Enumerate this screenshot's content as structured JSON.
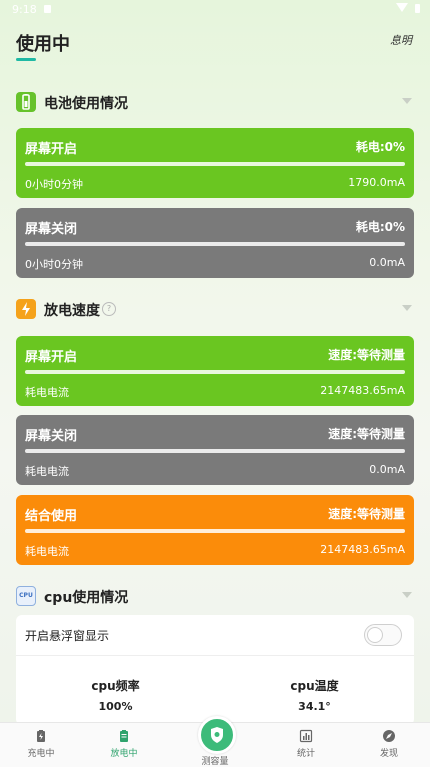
{
  "status_bar": {
    "time": "9:18"
  },
  "header": {
    "title": "使用中",
    "right_label": "息明"
  },
  "battery_section": {
    "title": "电池使用情况",
    "cards": [
      {
        "name": "屏幕开启",
        "consumption": "耗电:0%",
        "duration": "0小时0分钟",
        "current": "1790.0mA",
        "color": "#6ac621"
      },
      {
        "name": "屏幕关闭",
        "consumption": "耗电:0%",
        "duration": "0小时0分钟",
        "current": "0.0mA",
        "color": "#7a7a7a"
      }
    ]
  },
  "discharge_section": {
    "title": "放电速度",
    "cards": [
      {
        "name": "屏幕开启",
        "speed": "速度:等待测量",
        "label": "耗电电流",
        "current": "2147483.65mA",
        "color": "#6ac621"
      },
      {
        "name": "屏幕关闭",
        "speed": "速度:等待测量",
        "label": "耗电电流",
        "current": "0.0mA",
        "color": "#7a7a7a"
      },
      {
        "name": "结合使用",
        "speed": "速度:等待测量",
        "label": "耗电电流",
        "current": "2147483.65mA",
        "color": "#fb8c0a"
      }
    ]
  },
  "cpu_section": {
    "title": "cpu使用情况",
    "icon_text": "CPU",
    "floating_toggle_label": "开启悬浮窗显示",
    "floating_toggle_on": false,
    "frequency_label": "cpu频率",
    "frequency_value": "100%",
    "temperature_label": "cpu温度",
    "temperature_value": "34.1°"
  },
  "nav": {
    "items": [
      {
        "label": "充电中",
        "icon": "battery-charging-icon"
      },
      {
        "label": "放电中",
        "icon": "battery-icon",
        "active": true
      },
      {
        "label": "测容量",
        "icon": "shield-leaf-icon"
      },
      {
        "label": "统计",
        "icon": "bar-chart-icon"
      },
      {
        "label": "发现",
        "icon": "compass-icon"
      }
    ]
  }
}
